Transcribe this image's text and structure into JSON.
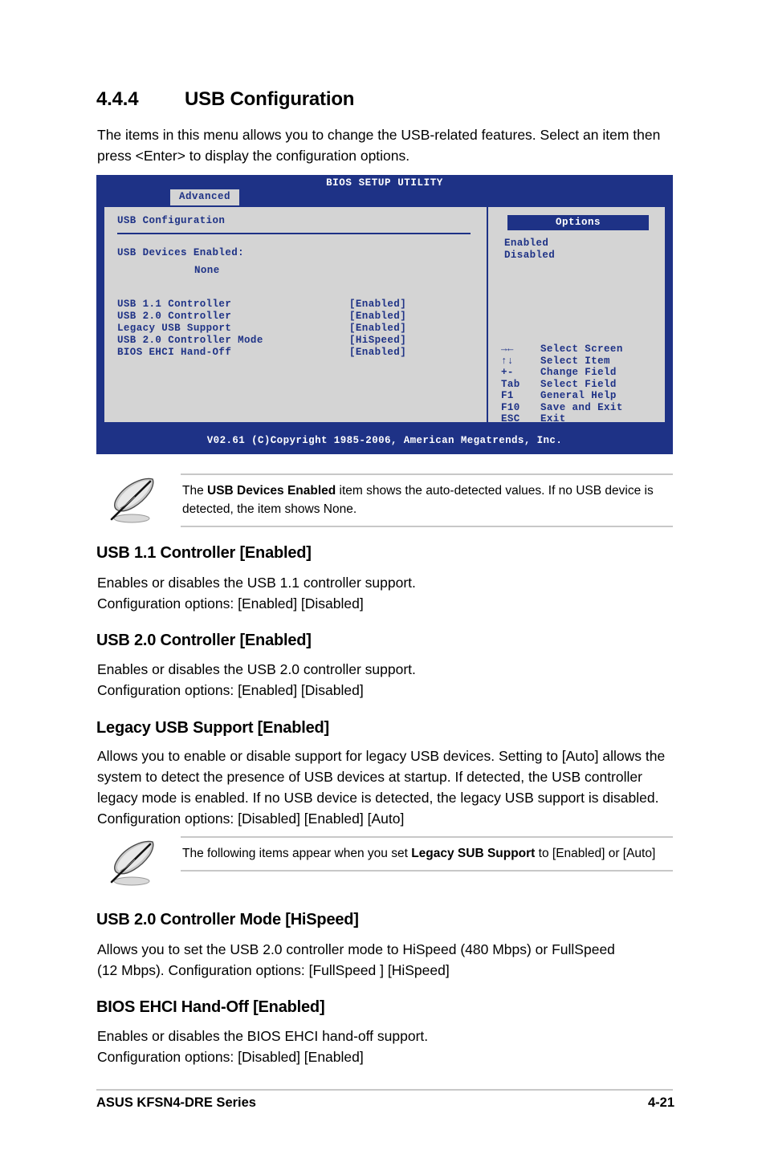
{
  "heading": {
    "number": "4.4.4",
    "title": "USB Configuration"
  },
  "intro": "The items in this menu allows you to change the USB-related features. Select an item then press <Enter> to display the configuration options.",
  "bios": {
    "title": "BIOS SETUP UTILITY",
    "active_tab": "Advanced",
    "section_title": "USB Configuration",
    "devices_label": "USB Devices Enabled:",
    "devices_value": "None",
    "items": [
      {
        "label": "USB 1.1 Controller",
        "value": "[Enabled]"
      },
      {
        "label": "USB 2.0 Controller",
        "value": "[Enabled]"
      },
      {
        "label": "Legacy USB Support",
        "value": "[Enabled]"
      },
      {
        "label": "USB 2.0 Controller Mode",
        "value": "[HiSpeed]"
      },
      {
        "label": "BIOS EHCI Hand-Off",
        "value": "[Enabled]"
      }
    ],
    "options_header": "Options",
    "options": [
      "Enabled",
      "Disabled"
    ],
    "nav": [
      {
        "key": "→←",
        "desc": "Select Screen"
      },
      {
        "key": "↑↓",
        "desc": "Select Item"
      },
      {
        "key": "+-",
        "desc": "Change Field"
      },
      {
        "key": "Tab",
        "desc": "Select Field"
      },
      {
        "key": "F1",
        "desc": "General Help"
      },
      {
        "key": "F10",
        "desc": "Save and Exit"
      },
      {
        "key": "ESC",
        "desc": "Exit"
      }
    ],
    "footer": "V02.61 (C)Copyright 1985-2006, American Megatrends, Inc.",
    "colors": {
      "chrome": "#1e3286",
      "panel": "#d4d4d4",
      "text": "#1e3286",
      "inverse_text": "#ffffff"
    }
  },
  "note1": {
    "text_before": "The ",
    "text_bold": "USB Devices Enabled",
    "text_after": " item shows the auto-detected values. If no USB device is detected, the item shows None."
  },
  "note2": {
    "text_before": "The following items appear when you set ",
    "text_bold": "Legacy SUB Support",
    "text_after": " to [Enabled] or [Auto]"
  },
  "sections": [
    {
      "title": "USB 1.1 Controller [Enabled]",
      "desc": "Enables or disables the USB 1.1 controller support. Configuration options: [Enabled] [Disabled]",
      "line1": "Enables or disables the USB 1.1 controller support.",
      "line2": "Configuration options: [Enabled] [Disabled]"
    },
    {
      "title": "USB 2.0 Controller [Enabled]",
      "desc": "Enables or disables the USB 2.0 controller support. Configuration options: [Enabled] [Disabled]",
      "line1": "Enables or disables the USB 2.0 controller support.",
      "line2": "Configuration options: [Enabled] [Disabled]"
    },
    {
      "title": "Legacy USB Support [Enabled]",
      "desc": "Allows you to enable or disable support for legacy USB devices. Setting to [Auto] allows the system to detect the presence of USB devices at startup. If detected, the USB controller legacy mode is enabled. If no USB device is detected, the legacy USB support is disabled. Configuration options: [Disabled] [Enabled] [Auto]"
    },
    {
      "title": "USB 2.0 Controller Mode [HiSpeed]",
      "desc": "Allows you to set the USB 2.0 controller mode to HiSpeed (480 Mbps) or FullSpeed (12 Mbps). Configuration options: [FullSpeed ] [HiSpeed]"
    },
    {
      "title": "BIOS EHCI Hand-Off [Enabled]",
      "desc": "Enables or disables the BIOS EHCI hand-off support. Configuration options: [Disabled] [Enabled]",
      "line1": "Enables or disables the BIOS EHCI hand-off support.",
      "line2": "Configuration options: [Disabled] [Enabled]"
    }
  ],
  "footer": {
    "left": "ASUS KFSN4-DRE Series",
    "right": "4-21"
  }
}
